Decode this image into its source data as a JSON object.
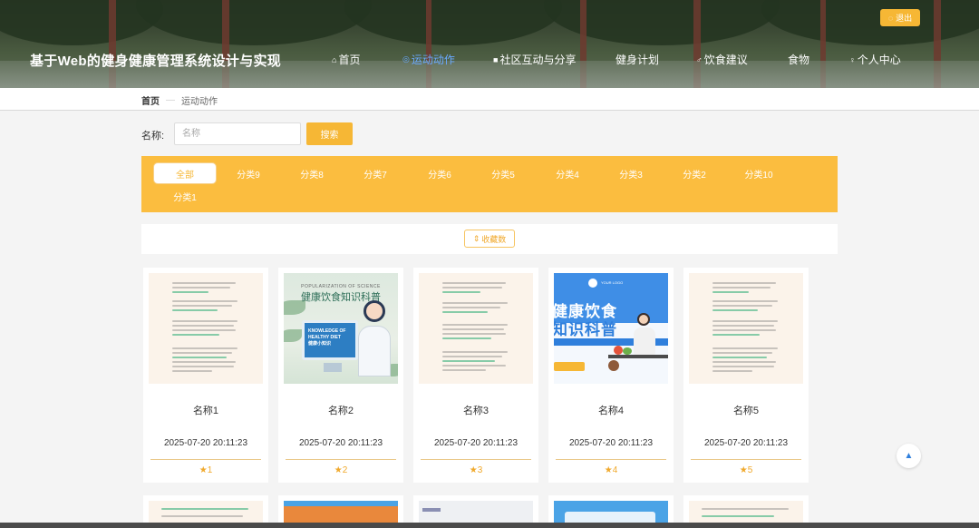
{
  "header": {
    "site_title": "基于Web的健身健康管理系统设计与实现",
    "logout_label": "退出",
    "nav": [
      {
        "label": "首页",
        "icon": "home-icon"
      },
      {
        "label": "运动动作",
        "icon": "dumbbell-icon",
        "active": true
      },
      {
        "label": "社区互动与分享",
        "icon": "square-icon"
      },
      {
        "label": "健身计划",
        "icon": ""
      },
      {
        "label": "饮食建议",
        "icon": "bike-icon"
      },
      {
        "label": "食物",
        "icon": ""
      },
      {
        "label": "个人中心",
        "icon": "user-icon"
      }
    ]
  },
  "breadcrumb": {
    "home": "首页",
    "current": "运动动作"
  },
  "search": {
    "label": "名称:",
    "placeholder": "名称",
    "button": "搜索"
  },
  "categories": [
    "全部",
    "分类9",
    "分类8",
    "分类7",
    "分类6",
    "分类5",
    "分类4",
    "分类3",
    "分类2",
    "分类10",
    "分类1"
  ],
  "sort": {
    "label": "收藏数"
  },
  "cards": [
    {
      "name": "名称1",
      "time": "2025-07-20 20:11:23",
      "rating": "1",
      "thumb": "document"
    },
    {
      "name": "名称2",
      "time": "2025-07-20 20:11:23",
      "rating": "2",
      "thumb": "healthy-diet-poster"
    },
    {
      "name": "名称3",
      "time": "2025-07-20 20:11:23",
      "rating": "3",
      "thumb": "document"
    },
    {
      "name": "名称4",
      "time": "2025-07-20 20:11:23",
      "rating": "4",
      "thumb": "diet-knowledge-poster"
    },
    {
      "name": "名称5",
      "time": "2025-07-20 20:11:23",
      "rating": "5",
      "thumb": "document"
    }
  ],
  "poster1": {
    "top_text": "POPULARIZATION OF SCIENCE",
    "title": "健康饮食知识科普",
    "monitor_en": "KNOWLEDGE OF HEALTHY DIET",
    "monitor_zh": "健康小知识"
  },
  "poster2": {
    "logo_text": "YOUR LOGO",
    "title_line1": "健康饮食",
    "title_line2": "知识科普"
  },
  "colors": {
    "accent": "#f6b735",
    "nav_active": "#6aa9ff",
    "category_bg": "#fbbd3f"
  }
}
